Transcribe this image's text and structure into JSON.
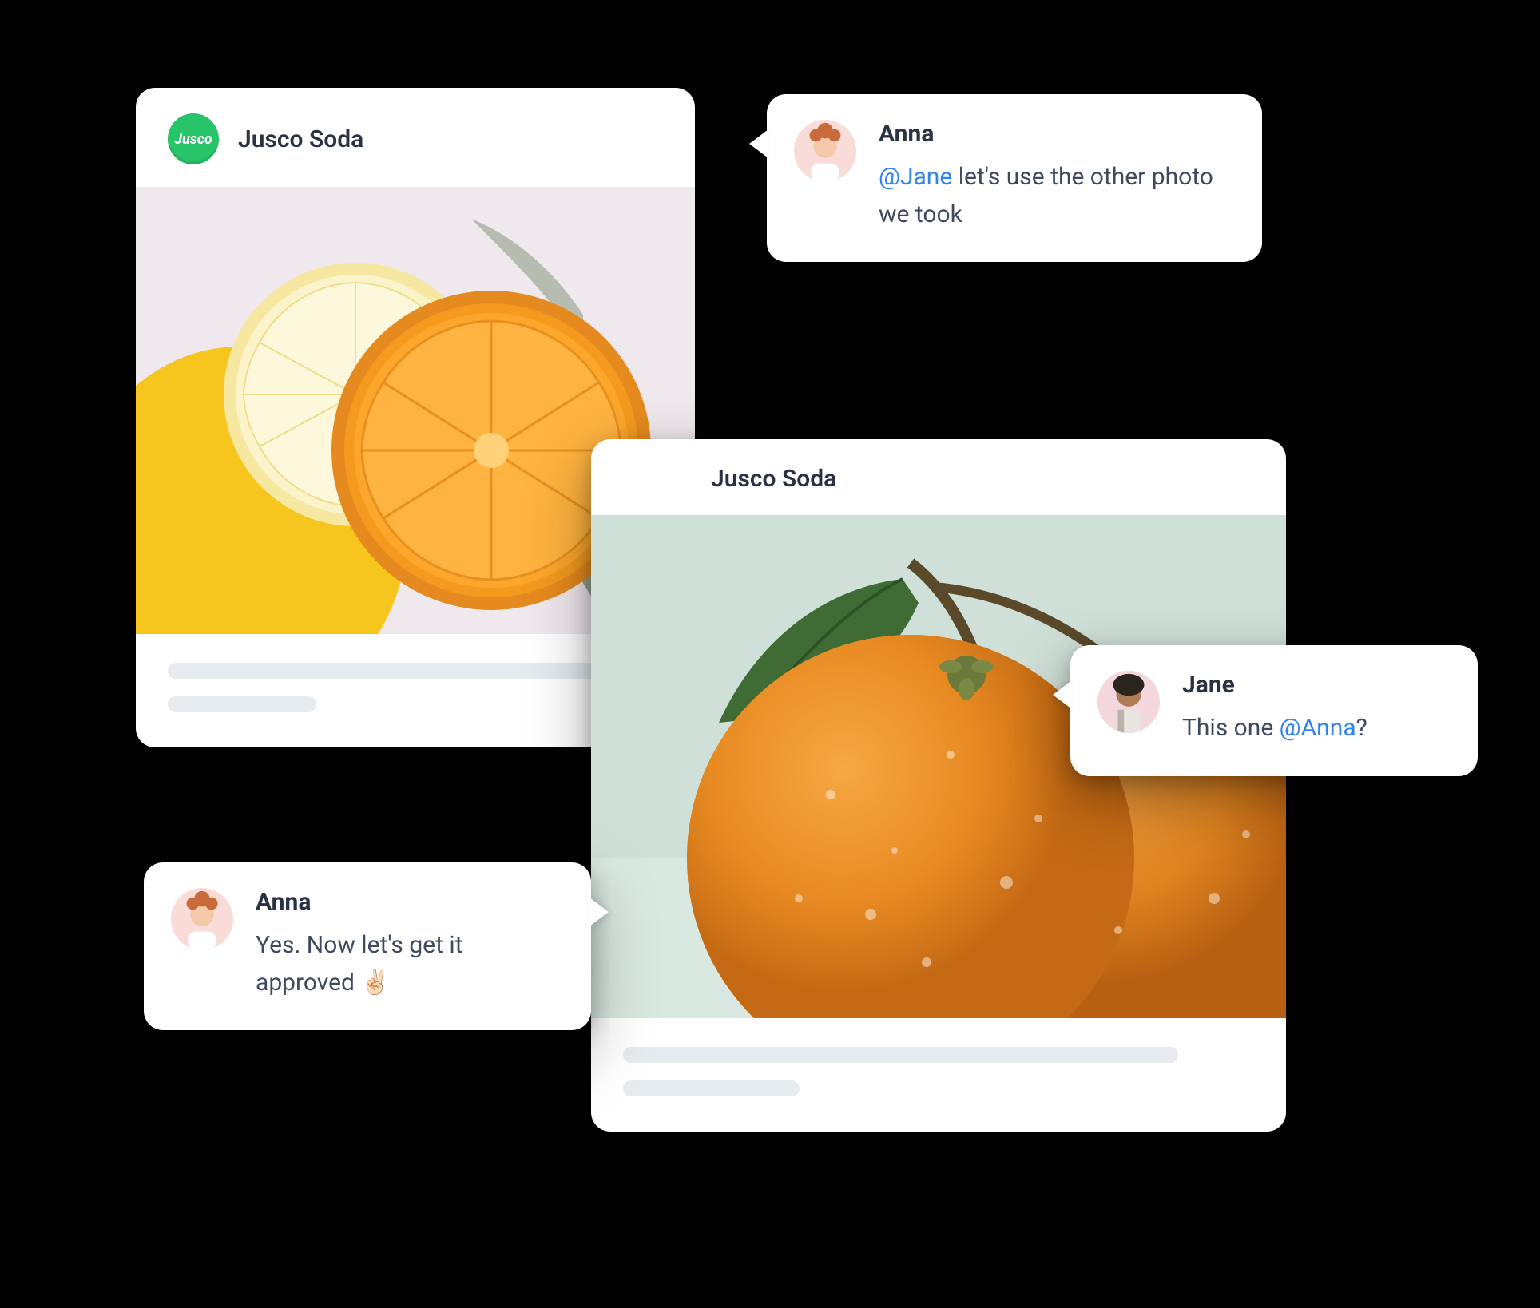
{
  "brand": {
    "name": "Jusco Soda",
    "badge_text": "Jusco",
    "badge_color": "#27c46a"
  },
  "posts": [
    {
      "id": "post-1",
      "account": "Jusco Soda",
      "image_alt": "Sliced orange and lemon on light background with green leaves"
    },
    {
      "id": "post-2",
      "account": "Jusco Soda",
      "image_alt": "Two whole oranges with water droplets and green leaf on pale green background"
    }
  ],
  "comments": [
    {
      "id": "c1",
      "author": "Anna",
      "mention": "@Jane",
      "text_after_mention": " let's use the other photo we took",
      "avatar": "anna"
    },
    {
      "id": "c2",
      "author": "Jane",
      "text_before_mention": "This one ",
      "mention": "@Anna",
      "text_after_mention": "?",
      "avatar": "jane"
    },
    {
      "id": "c3",
      "author": "Anna",
      "text": "Yes. Now let's get it approved ✌🏻",
      "avatar": "anna"
    }
  ],
  "colors": {
    "mention": "#2f85ef",
    "text_dark": "#2a3344",
    "text_body": "#3f4a5e",
    "skeleton": "#e7eaee"
  }
}
